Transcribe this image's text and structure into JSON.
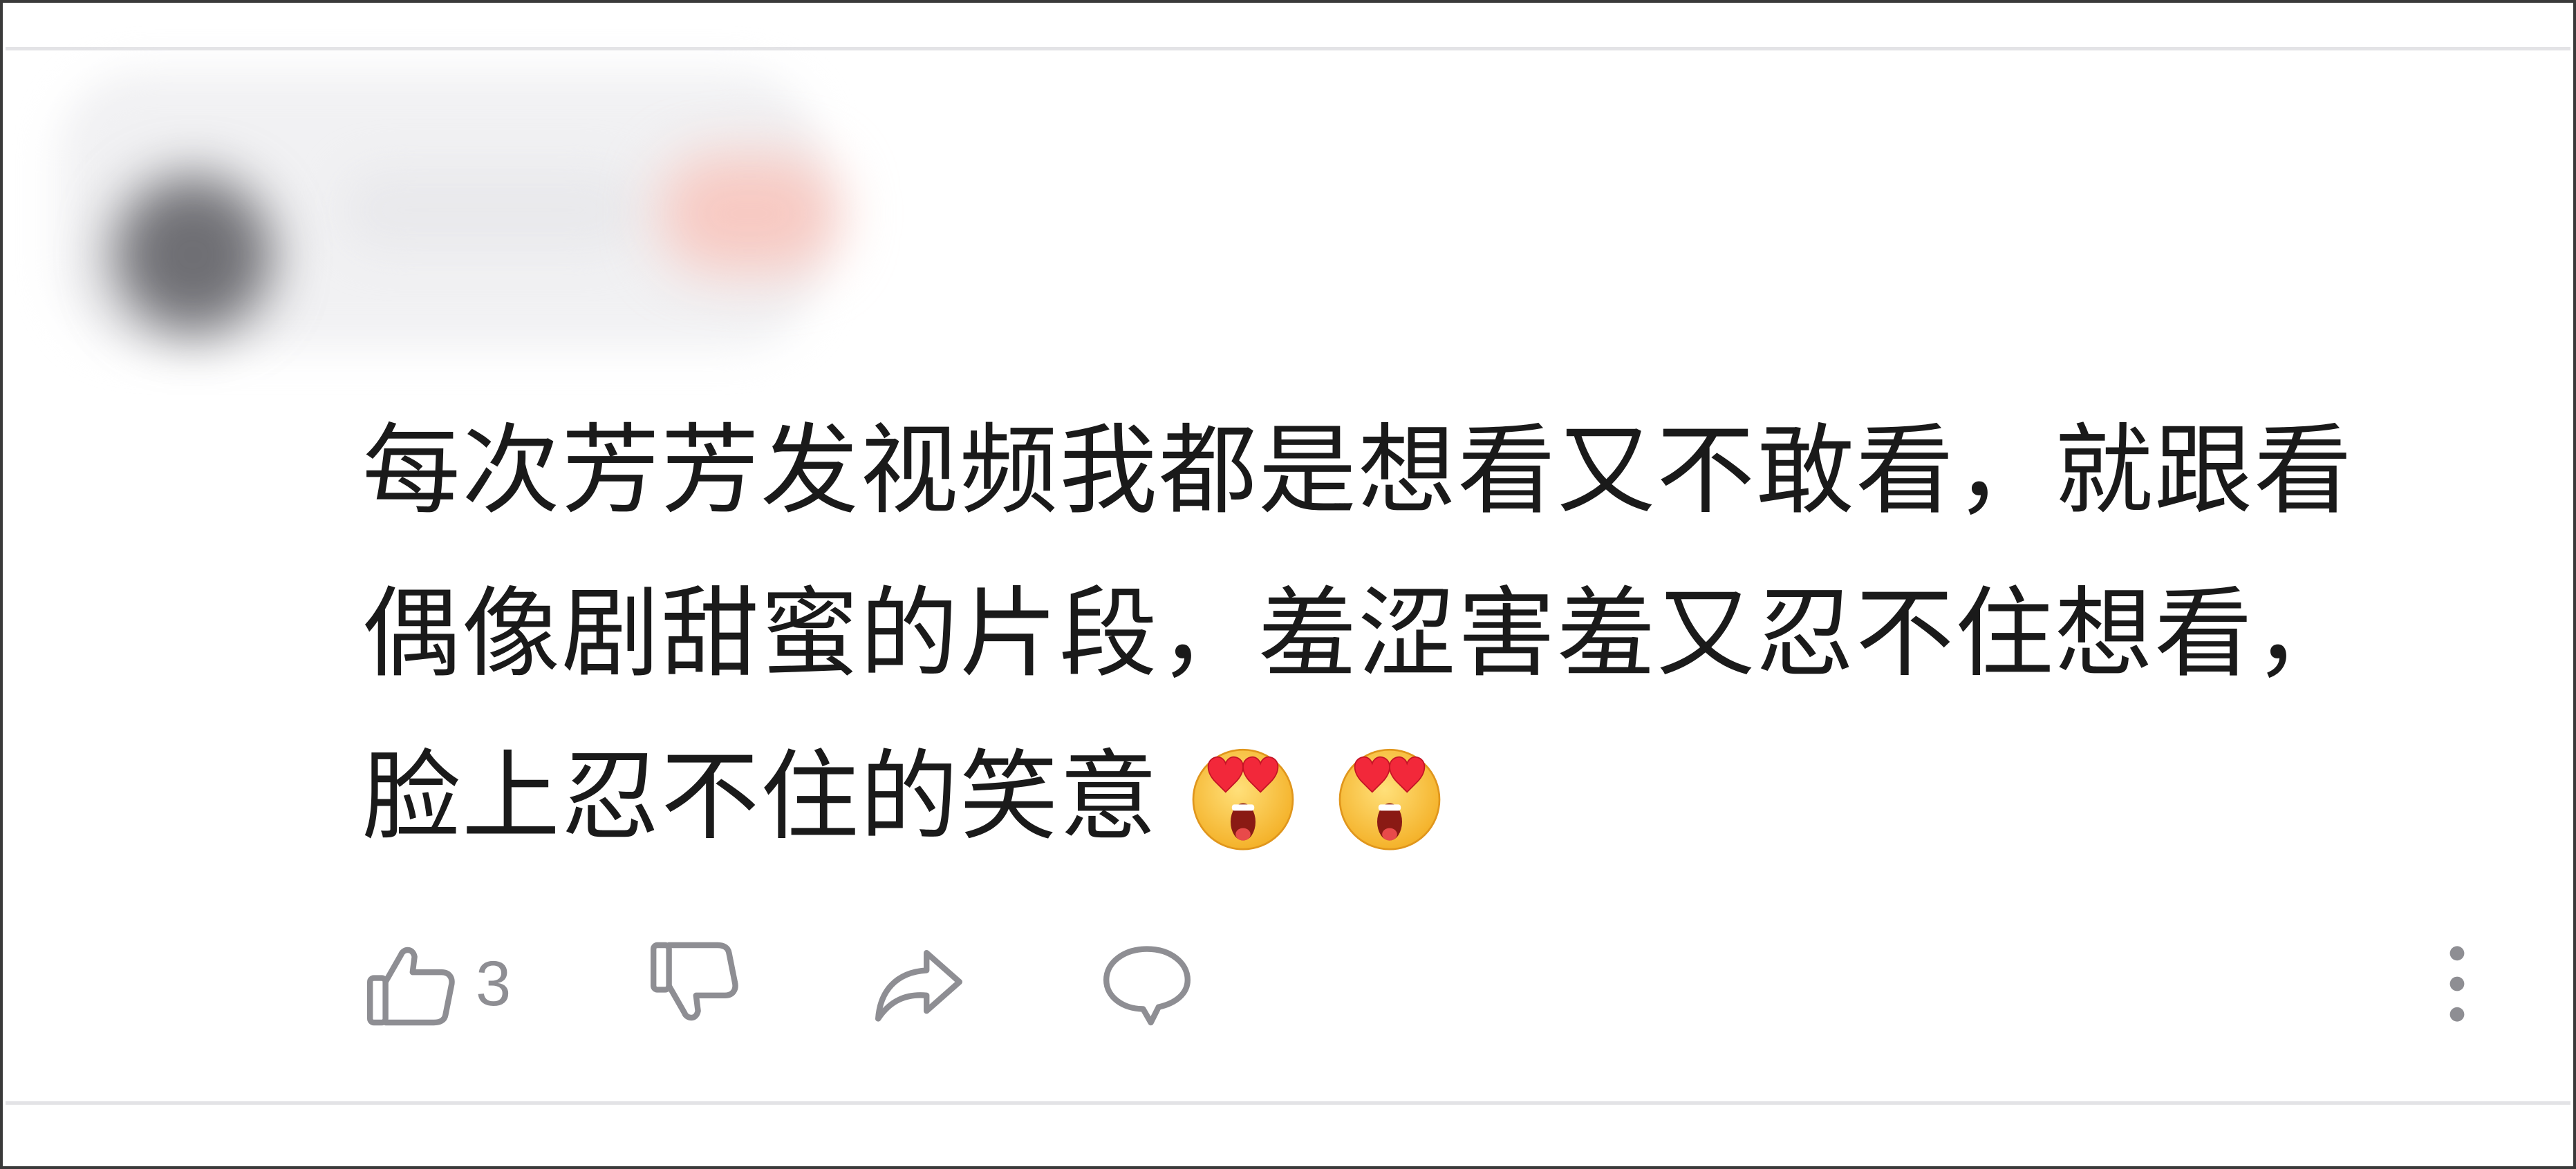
{
  "comment": {
    "text": "每次芳芳发视频我都是想看又不敢看，就跟看偶像剧甜蜜的片段，羞涩害羞又忍不住想看，脸上忍不住的笑意",
    "emojis": [
      "heart-eyes-screaming-emoji",
      "heart-eyes-screaming-emoji"
    ]
  },
  "actions": {
    "like_count": "3",
    "icons": [
      "thumbs-up-icon",
      "thumbs-down-icon",
      "share-icon",
      "reply-icon",
      "more-vertical-icon"
    ]
  },
  "colors": {
    "text": "#1a1a1a",
    "icon": "#8e8e93",
    "divider": "#e3e3e6"
  }
}
